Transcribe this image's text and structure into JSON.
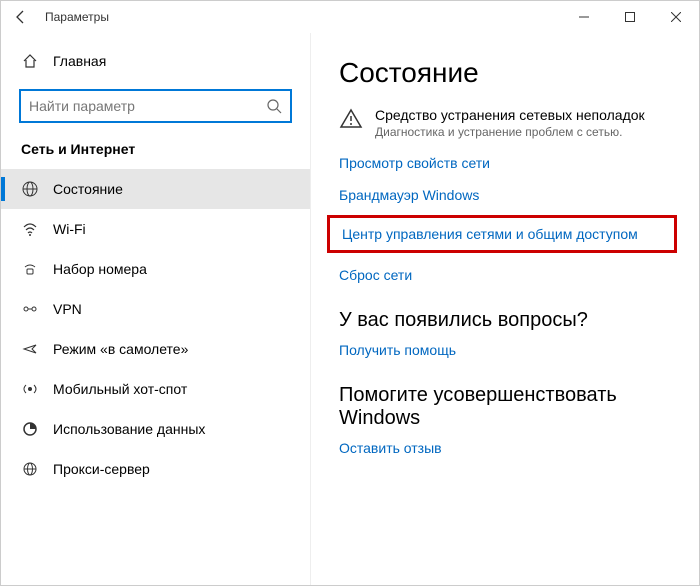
{
  "window": {
    "title": "Параметры"
  },
  "sidebar": {
    "home": "Главная",
    "search_placeholder": "Найти параметр",
    "section": "Сеть и Интернет",
    "items": [
      {
        "label": "Состояние",
        "icon": "globe-icon"
      },
      {
        "label": "Wi-Fi",
        "icon": "wifi-icon"
      },
      {
        "label": "Набор номера",
        "icon": "dialup-icon"
      },
      {
        "label": "VPN",
        "icon": "vpn-icon"
      },
      {
        "label": "Режим «в самолете»",
        "icon": "airplane-icon"
      },
      {
        "label": "Мобильный хот-спот",
        "icon": "hotspot-icon"
      },
      {
        "label": "Использование данных",
        "icon": "datausage-icon"
      },
      {
        "label": "Прокси-сервер",
        "icon": "proxy-icon"
      }
    ]
  },
  "main": {
    "heading": "Состояние",
    "troubleshoot": {
      "title": "Средство устранения сетевых неполадок",
      "subtitle": "Диагностика и устранение проблем с сетью."
    },
    "links": {
      "view_props": "Просмотр свойств сети",
      "firewall": "Брандмауэр Windows",
      "sharing_center": "Центр управления сетями и общим доступом",
      "reset": "Сброс сети"
    },
    "question_heading": "У вас появились вопросы?",
    "get_help": "Получить помощь",
    "feedback_heading": "Помогите усовершенствовать Windows",
    "feedback_link": "Оставить отзыв"
  }
}
